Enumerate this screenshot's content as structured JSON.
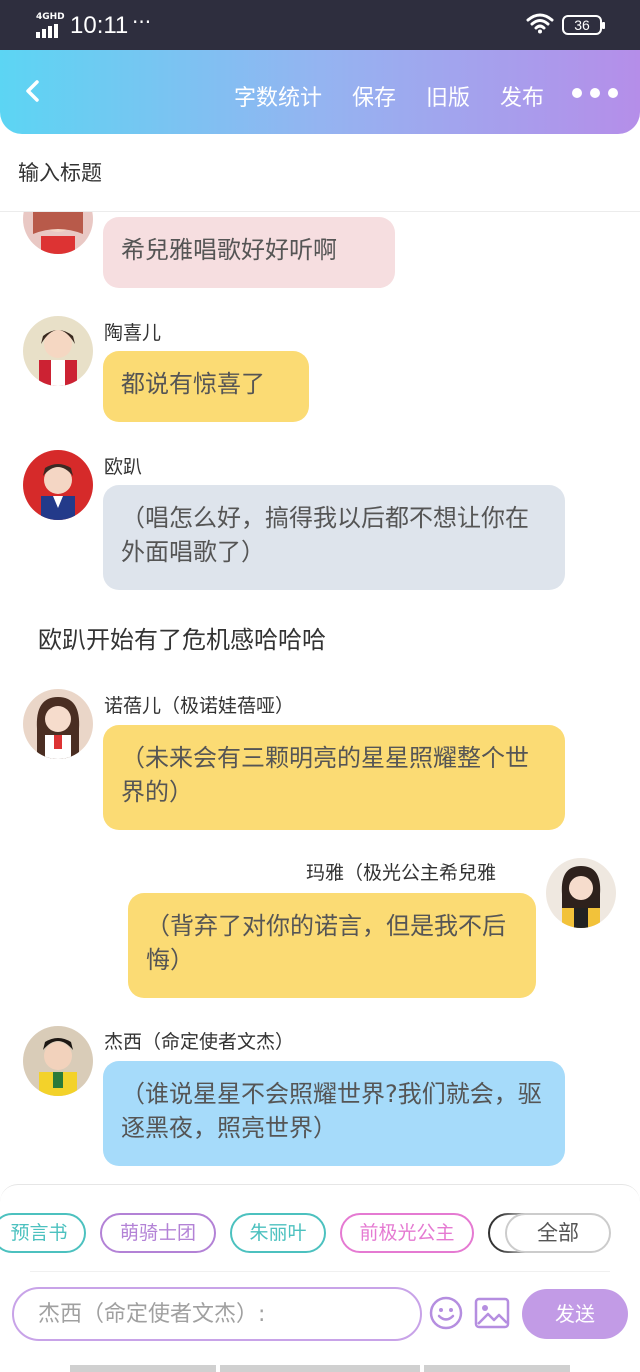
{
  "status_bar": {
    "network": "4GHD",
    "time": "10:11",
    "more": "···",
    "battery": "36"
  },
  "toolbar": {
    "word_count": "字数统计",
    "save": "保存",
    "old_version": "旧版",
    "publish": "发布"
  },
  "title_input": {
    "placeholder": "输入标题"
  },
  "messages": [
    {
      "name": "",
      "text": "希兒雅唱歌好好听啊",
      "color": "#f6dee0"
    },
    {
      "name": "陶喜儿",
      "text": "都说有惊喜了",
      "color": "#fbdb74"
    },
    {
      "name": "欧趴",
      "text": "（唱怎么好，搞得我以后都不想让你在外面唱歌了）",
      "color": "#dee4ec"
    },
    {
      "narration": "欧趴开始有了危机感哈哈哈"
    },
    {
      "name": "诺蓓儿（极诺娃蓓哑）",
      "text": "（未来会有三颗明亮的星星照耀整个世界的）",
      "color": "#fbdb74"
    },
    {
      "name": "玛雅（极光公主希兒雅",
      "text": "（背弃了对你的诺言，但是我不后悔）",
      "color": "#fbdb74"
    },
    {
      "name": "杰西（命定使者文杰）",
      "text": "（谁说星星不会照耀世界?我们就会，驱逐黑夜，照亮世界）",
      "color": "#a6dbfa"
    }
  ],
  "chips": [
    {
      "label": "预言书",
      "color": "#4cc1bf"
    },
    {
      "label": "萌骑士团",
      "color": "#b382d6"
    },
    {
      "label": "朱丽叶",
      "color": "#4cc1bf"
    },
    {
      "label": "前极光公主",
      "color": "#e57ad2"
    },
    {
      "label": "",
      "color": "#333333"
    }
  ],
  "chip_all": "全部",
  "composer": {
    "placeholder": "杰西（命定使者文杰）:",
    "send": "发送"
  },
  "icons": {
    "back": "chevron-left-icon",
    "more": "more-dots-icon",
    "emoji": "smiley-icon",
    "image": "image-icon",
    "wifi": "wifi-icon",
    "signal": "signal-icon",
    "battery": "battery-icon"
  },
  "colors": {
    "gradient_start": "#5cd5f3",
    "gradient_end": "#b58ee9",
    "send_button": "#c29be6"
  }
}
